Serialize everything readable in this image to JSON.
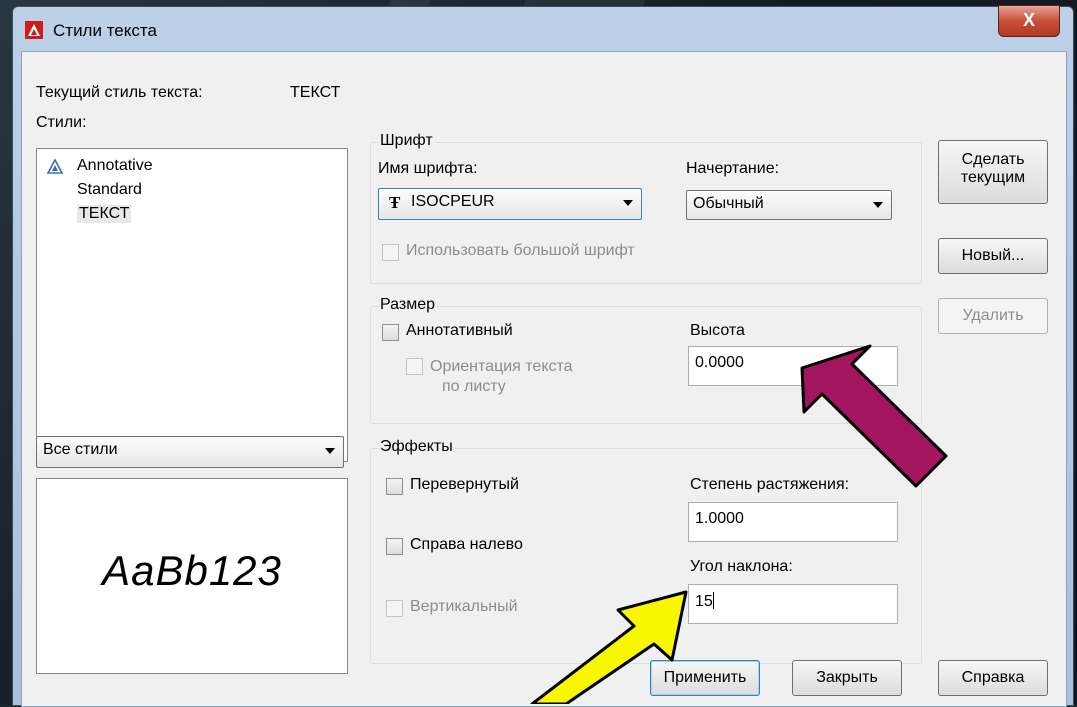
{
  "window": {
    "title": "Стили текста",
    "close_label": "X"
  },
  "current_style": {
    "label": "Текущий стиль текста:",
    "value": "ТЕКСТ"
  },
  "styles": {
    "label": "Стили:",
    "items": [
      {
        "label": "Annotative",
        "icon": "annotative-icon"
      },
      {
        "label": "Standard"
      },
      {
        "label": "ТЕКСТ",
        "selected": true
      }
    ],
    "filter": "Все стили"
  },
  "preview": {
    "text": "AaBb123"
  },
  "font_group": {
    "title": "Шрифт",
    "name_label": "Имя шрифта:",
    "name_value": "ISOCPEUR",
    "font_icon": "truetype-font-icon",
    "style_label": "Начертание:",
    "style_value": "Обычный",
    "bigfont_label": "Использовать большой шрифт"
  },
  "size_group": {
    "title": "Размер",
    "annotative_label": "Аннотативный",
    "orientation_label_1": "Ориентация текста",
    "orientation_label_2": "по листу",
    "height_label": "Высота",
    "height_value": "0.0000"
  },
  "effects_group": {
    "title": "Эффекты",
    "upside_down_label": "Перевернутый",
    "backwards_label": "Справа налево",
    "vertical_label": "Вертикальный",
    "width_factor_label": "Степень растяжения:",
    "width_factor_value": "1.0000",
    "oblique_label": "Угол наклона:",
    "oblique_value": "15"
  },
  "side_buttons": {
    "set_current_1": "Сделать",
    "set_current_2": "текущим",
    "new": "Новый...",
    "delete": "Удалить"
  },
  "bottom_buttons": {
    "apply": "Применить",
    "close": "Закрыть",
    "help": "Справка"
  },
  "annotations": {
    "arrow_height_color": "#a3155e",
    "arrow_oblique_color": "#f7f700"
  }
}
